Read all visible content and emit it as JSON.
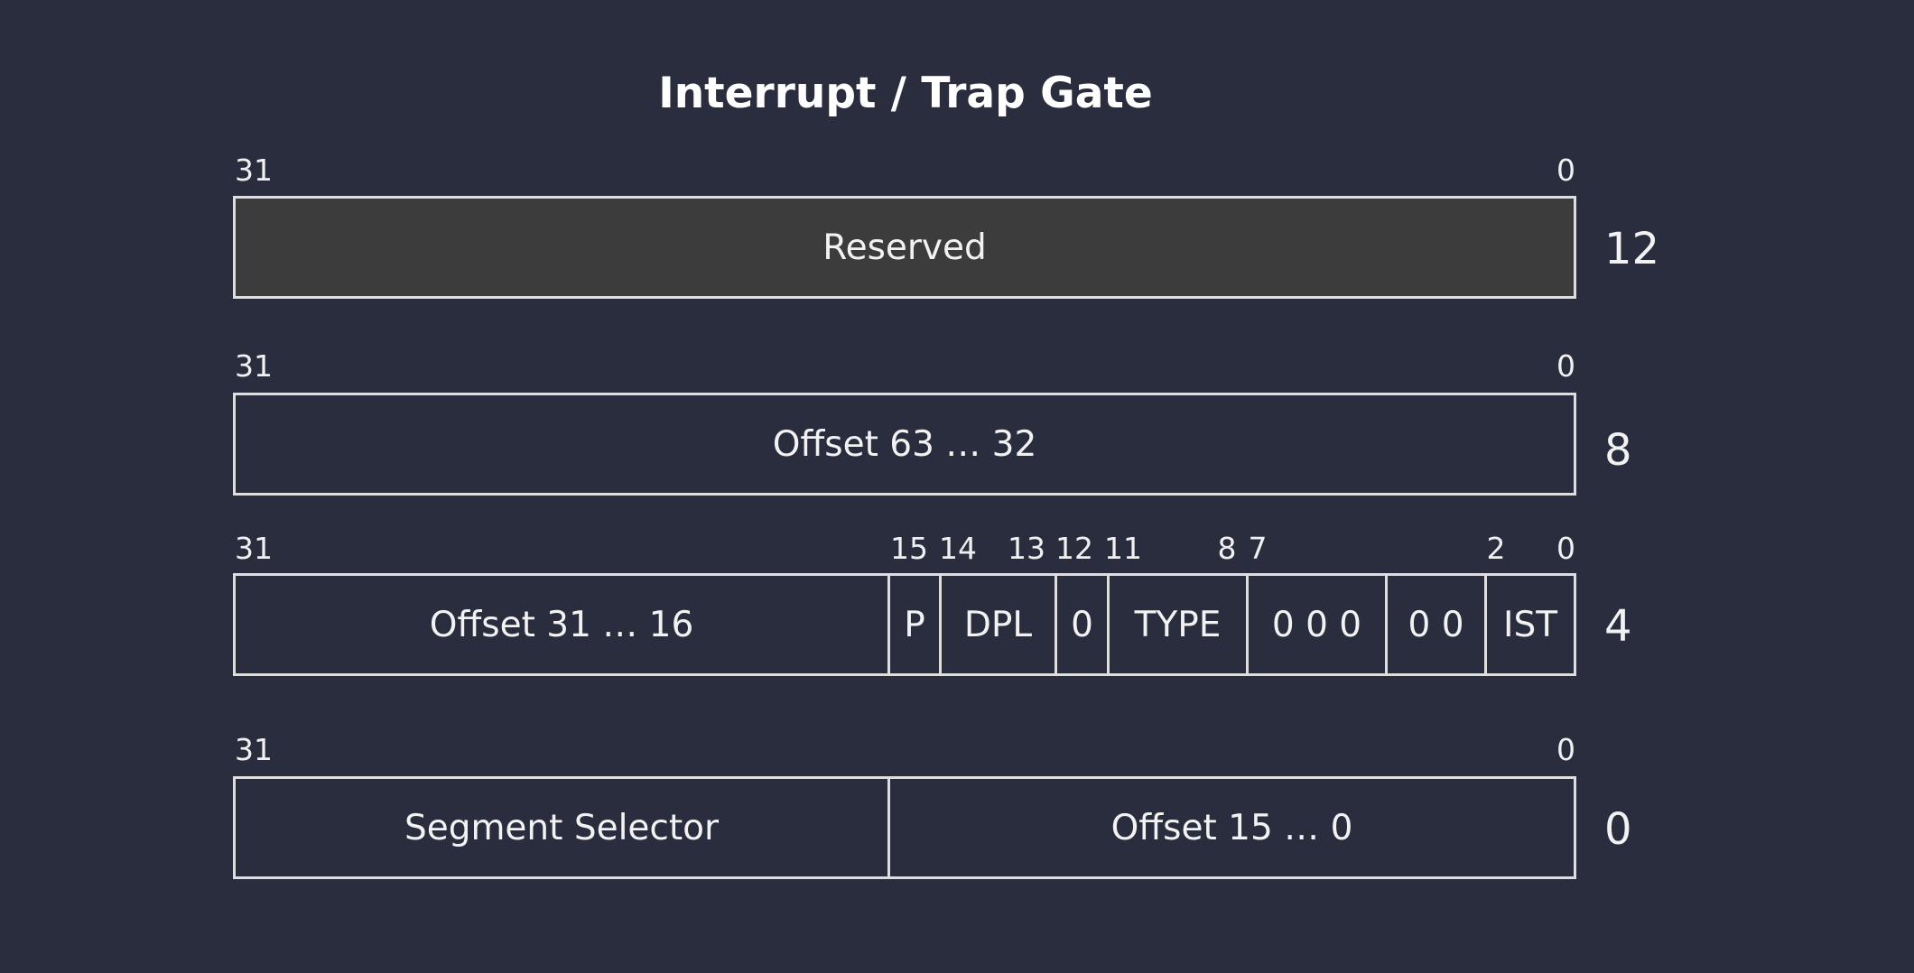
{
  "title": "Interrupt / Trap Gate",
  "rows": [
    {
      "offset": "12",
      "bit_labels": [
        "31",
        "0"
      ],
      "fields": [
        "Reserved"
      ]
    },
    {
      "offset": "8",
      "bit_labels": [
        "31",
        "0"
      ],
      "fields": [
        "Offset 63 … 32"
      ]
    },
    {
      "offset": "4",
      "bit_labels": [
        "31",
        "15",
        "14",
        "13",
        "12",
        "11",
        "8",
        "7",
        "2",
        "0"
      ],
      "fields": [
        "Offset 31 … 16",
        "P",
        "DPL",
        "0",
        "TYPE",
        "0 0 0",
        "0 0",
        "IST"
      ]
    },
    {
      "offset": "0",
      "bit_labels": [
        "31",
        "0"
      ],
      "fields": [
        "Segment Selector",
        "Offset 15 … 0"
      ]
    }
  ],
  "colors": {
    "background": "#2a2d3e",
    "reserved_fill": "#3c3c3c",
    "border": "#dedede",
    "text": "#f2f2f2"
  }
}
